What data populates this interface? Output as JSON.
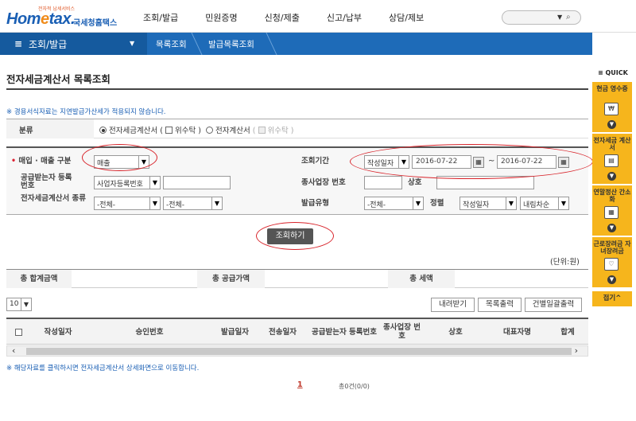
{
  "header": {
    "logo_tagline": "전자적 납세서비스",
    "logo_brand": "Hometax",
    "logo_kr": "국세청홈택스",
    "nav": [
      "조회/발급",
      "민원증명",
      "신청/제출",
      "신고/납부",
      "상담/제보"
    ]
  },
  "bluenav": {
    "menu_label": "조회/발급",
    "crumbs": [
      "목록조회",
      "발급목록조회"
    ]
  },
  "page": {
    "title": "전자세금계산서 목록조회",
    "note_top": "※ 경용서식자료는 지연발급가산세가 적용되지 않습니다.",
    "note_bottom": "※ 해당자료를 클릭하시면 전자세금계산서 상세화면으로 이동합니다."
  },
  "classification": {
    "label": "분류",
    "opt1": "전자세금계산서",
    "opt1_sub": "위수탁",
    "opt2": "전자계산서",
    "opt2_sub": "위수탁"
  },
  "search": {
    "trade_label": "매입 · 매출 구분",
    "trade_value": "매출",
    "period_label": "조회기간",
    "period_type": "작성일자",
    "date_from": "2016-07-22",
    "date_to": "2016-07-22",
    "receiver_label": "공급받는자 등록번호",
    "receiver_type": "사업자등록번호",
    "sub_biz_label": "종사업장 번호",
    "company_label": "상호",
    "kind_label": "전자세금계산서 종류",
    "kind1": "-전체-",
    "kind2": "-전체-",
    "issue_type_label": "발급유형",
    "issue_type": "-전체-",
    "sort_label": "정렬",
    "sort_field": "작성일자",
    "sort_order": "내림차순",
    "button": "조회하기",
    "unit": "(단위:원)"
  },
  "totals": {
    "total_amount_label": "총 합계금액",
    "supply_label": "총 공급가액",
    "tax_label": "총 세액"
  },
  "list": {
    "page_size": "10",
    "download_btn": "내려받기",
    "print_btn": "목록출력",
    "bulk_print_btn": "건별일괄출력",
    "columns": [
      "작성일자",
      "승인번호",
      "발급일자",
      "전송일자",
      "공급받는자 등록번호",
      "종사업장 번호",
      "상호",
      "대표자명",
      "합계"
    ],
    "page": "1",
    "count": "총0건(0/0)"
  },
  "quick": {
    "title": "≡ QUICK",
    "items": [
      "현금 영수증",
      "전자세금 계산서",
      "연말정산 간소화",
      "근로장려금 자녀장려금"
    ],
    "fold": "접기^"
  },
  "colors": {
    "brand_blue": "#1e6bb8",
    "quick_yellow": "#f6b51c",
    "annotation_red": "#d8232a"
  }
}
